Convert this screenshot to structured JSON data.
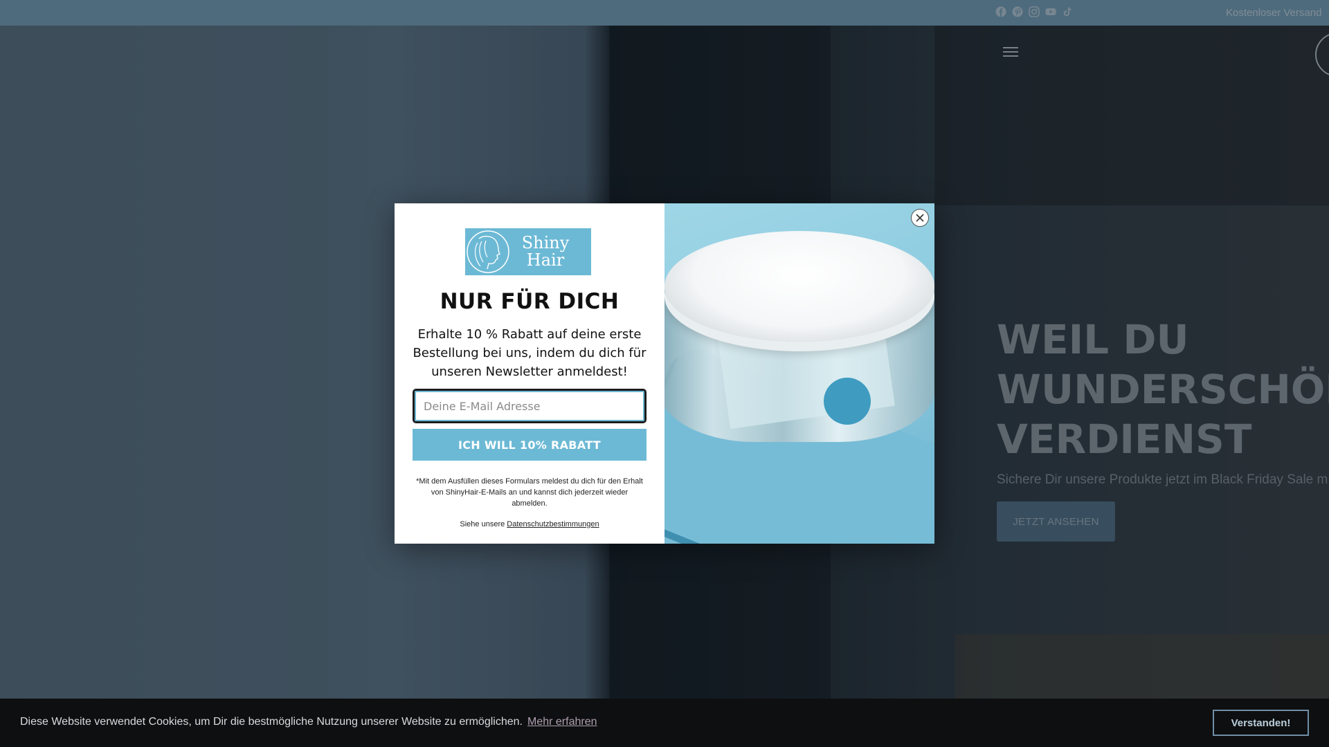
{
  "announcement": {
    "text": "Kostenloser Versand",
    "social_icons": [
      "facebook-icon",
      "pinterest-icon",
      "instagram-icon",
      "youtube-icon",
      "tiktok-icon"
    ]
  },
  "hero": {
    "title_lines": [
      "WEIL DU",
      "WUNDERSCHÖNI",
      "VERDIENST"
    ],
    "subtitle": "Sichere Dir unsere Produkte jetzt im Black Friday Sale m",
    "button_label": "JETZT ANSEHEN"
  },
  "popup": {
    "brand_line1": "Shiny",
    "brand_line2": "Hair",
    "heading": "NUR FÜR DICH",
    "text": "Erhalte 10 % Rabatt auf deine erste Bestellung bei uns, indem du dich für unseren Newsletter anmeldest!",
    "email_placeholder": "Deine E-Mail Adresse",
    "cta_label": "ICH WILL 10% RABATT",
    "disclaimer": "*Mit dem Ausfüllen dieses Formulars meldest du dich für den Erhalt von ShinyHair-E-Mails an und kannst dich jederzeit wieder abmelden.",
    "privacy_prefix": "Siehe unsere",
    "privacy_link": "Datenschutzbestimmungen"
  },
  "cookie": {
    "text": "Diese Website verwendet Cookies, um Dir die bestmögliche Nutzung unserer Website zu ermöglichen.",
    "more_link": "Mehr erfahren",
    "accept_label": "Verstanden!"
  },
  "colors": {
    "topbar": "#7fa9c4",
    "brand": "#6cb9d5",
    "cookie_bg": "#0e0f10"
  }
}
